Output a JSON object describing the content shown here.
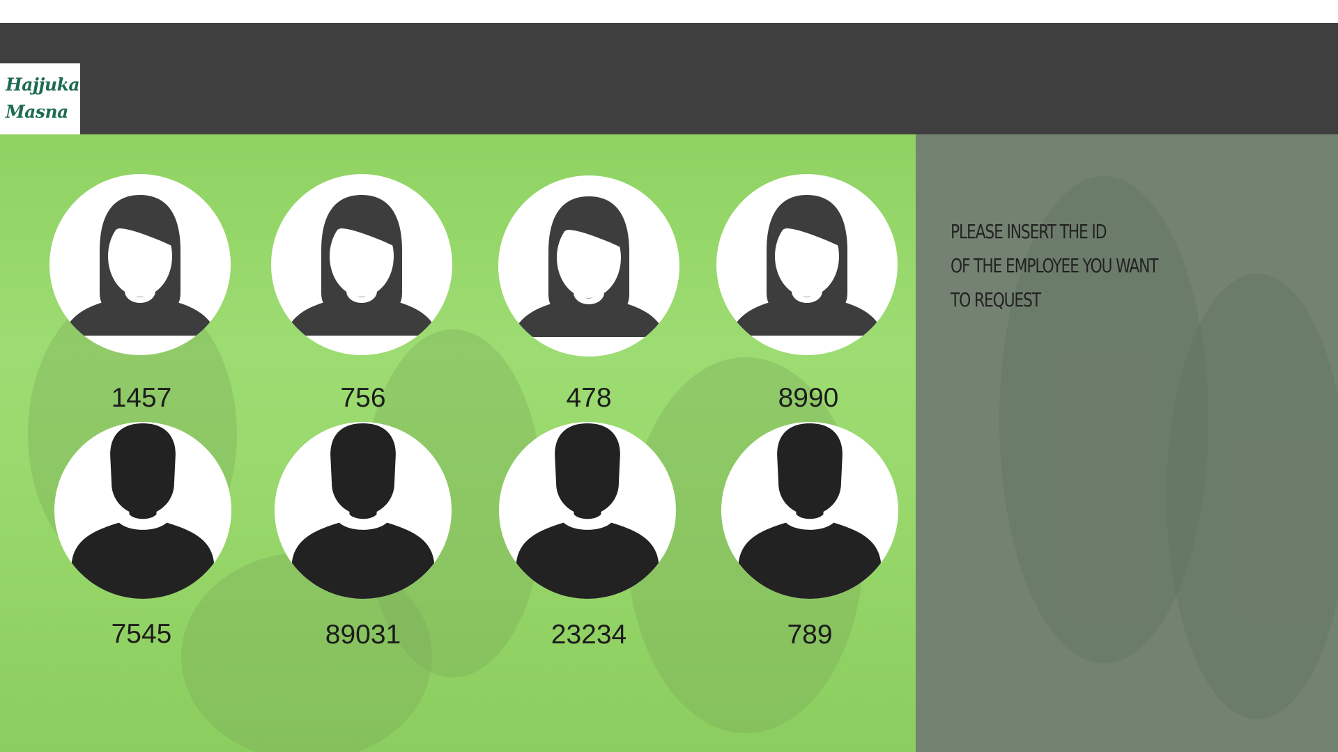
{
  "header": {
    "logo_line1": "Hajjuka",
    "logo_line2": "Masna"
  },
  "instruction": {
    "line1": "Please insert the ID",
    "line2": "of the employee you want",
    "line3": "to request"
  },
  "employees": {
    "female": [
      {
        "id": "1457",
        "icon": "female-avatar-icon"
      },
      {
        "id": "756",
        "icon": "female-avatar-icon"
      },
      {
        "id": "478",
        "icon": "female-avatar-icon"
      },
      {
        "id": "8990",
        "icon": "female-avatar-icon"
      }
    ],
    "male": [
      {
        "id": "7545",
        "icon": "male-avatar-icon"
      },
      {
        "id": "89031",
        "icon": "male-avatar-icon"
      },
      {
        "id": "23234",
        "icon": "male-avatar-icon"
      },
      {
        "id": "789",
        "icon": "male-avatar-icon"
      }
    ]
  },
  "colors": {
    "header": "#3f3f3f",
    "green_panel": "#98d86b",
    "grey_panel": "#748371",
    "logo_text": "#1e6b52",
    "avatar_dark": "#3d3d3d"
  }
}
